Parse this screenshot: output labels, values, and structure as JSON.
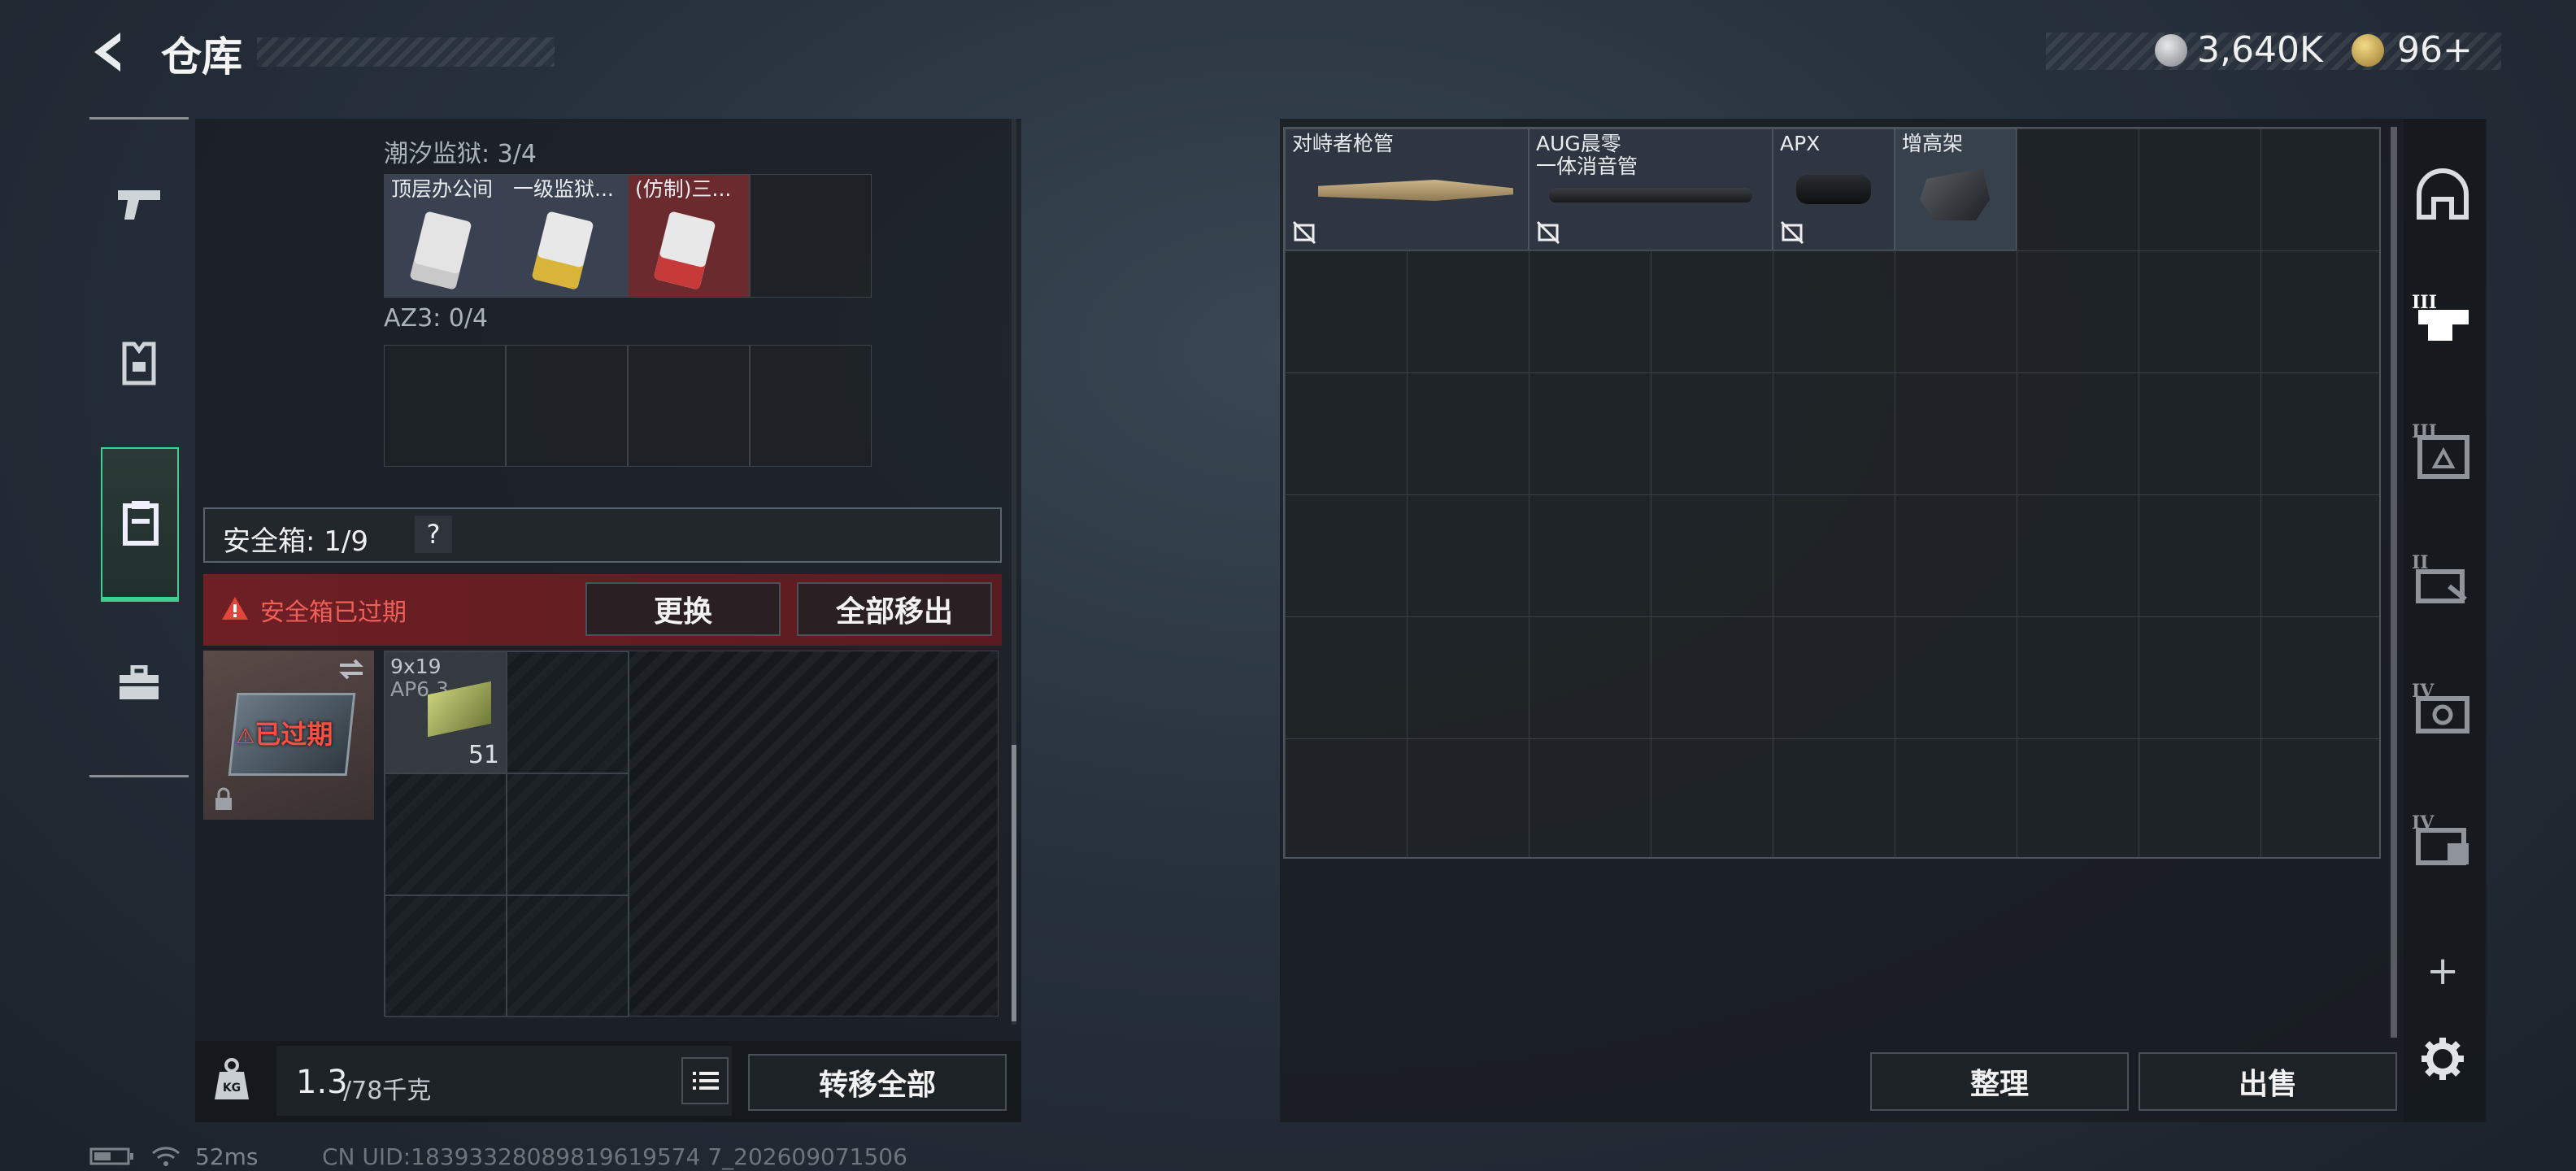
{
  "header": {
    "title": "仓库",
    "currency1_value": "3,640K",
    "currency2_value": "96+"
  },
  "left_nav": {
    "items": [
      {
        "name": "weapons",
        "icon": "pistol-icon",
        "selected": false
      },
      {
        "name": "armor",
        "icon": "vest-icon",
        "selected": false
      },
      {
        "name": "secure-container",
        "icon": "container-icon",
        "selected": true
      },
      {
        "name": "toolbox",
        "icon": "toolbox-icon",
        "selected": false
      }
    ]
  },
  "keycards": {
    "section1_label": "潮汐监狱: 3/4",
    "items": [
      {
        "name": "顶层办公间",
        "color": "#c9c9c9"
      },
      {
        "name": "一级监狱...",
        "color": "#d8b43a"
      },
      {
        "name": "(仿制)三...",
        "color": "#c63a3a"
      }
    ],
    "section2_label": "AZ3: 0/4"
  },
  "safe_box": {
    "label": "安全箱: 1/9",
    "help": "?",
    "expired_warning": "安全箱已过期",
    "replace_label": "更换",
    "remove_all_label": "全部移出",
    "expired_badge": "已过期",
    "ammo_name": "9x19",
    "ammo_sub": "AP6.3",
    "ammo_count": "51"
  },
  "footer_left": {
    "weight_current": "1.3",
    "weight_max": "/78千克",
    "transfer_all_label": "转移全部"
  },
  "stash": {
    "items": [
      {
        "name": "对峙者枪管"
      },
      {
        "name": "AUG晨零\n一体消音管"
      },
      {
        "name": "APX"
      },
      {
        "name": "增高架"
      }
    ],
    "tidy_label": "整理",
    "sell_label": "出售"
  },
  "right_nav": {
    "items": [
      {
        "icon": "helmet-icon",
        "level": ""
      },
      {
        "icon": "weapon-case-icon",
        "level": "III"
      },
      {
        "icon": "box-level-icon",
        "level": "III"
      },
      {
        "icon": "card-case-icon",
        "level": "II"
      },
      {
        "icon": "safe-icon",
        "level": "IV"
      },
      {
        "icon": "file-case-icon",
        "level": "IV"
      }
    ],
    "add_label": "+"
  },
  "status_bar": {
    "ping": "52ms",
    "uid": "CN UID:18393328089819619574 7_202609071506"
  },
  "colors": {
    "warning_red": "#e2453c",
    "selected_green": "#3fcf8e",
    "panel_dark": "#181c20"
  }
}
